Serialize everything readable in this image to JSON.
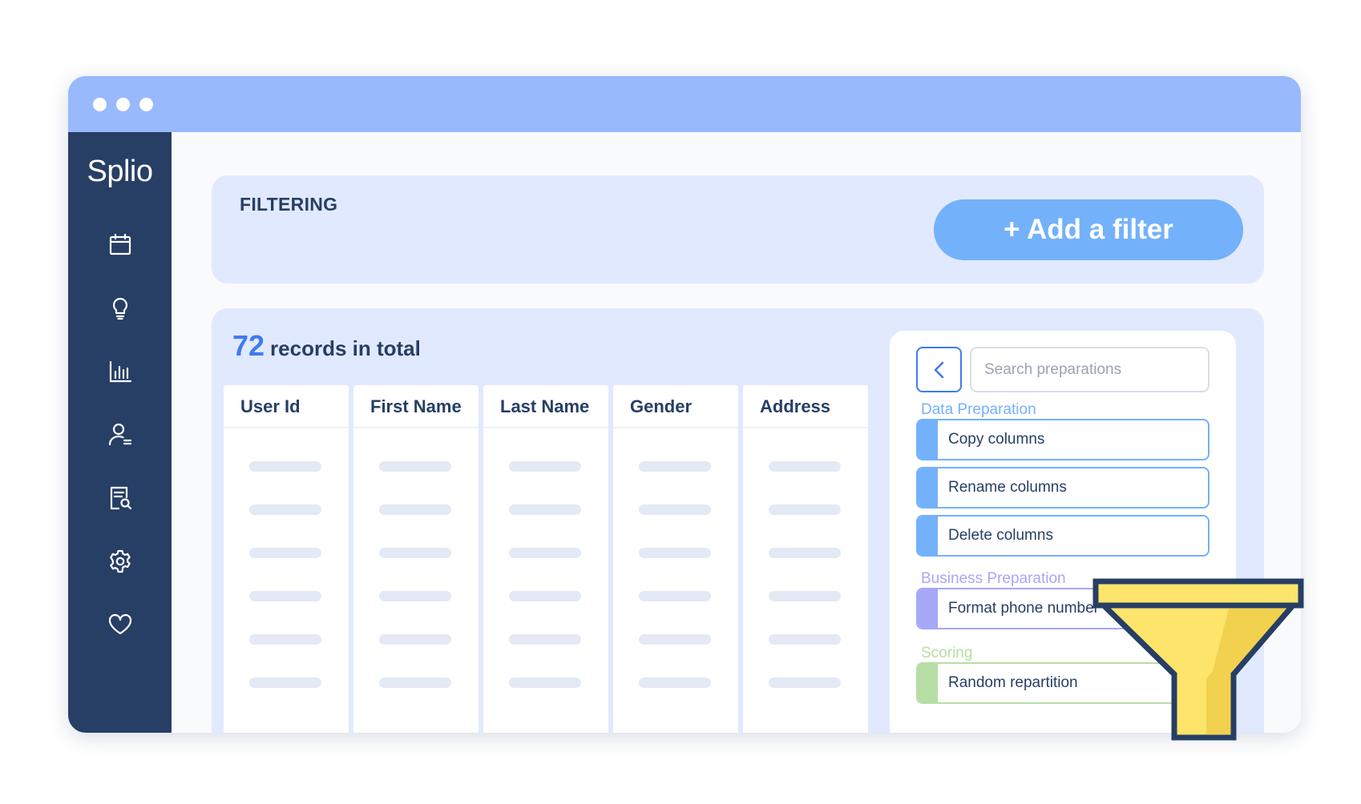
{
  "window": {
    "control_dots": [
      "dot",
      "dot",
      "dot"
    ]
  },
  "sidebar": {
    "logo": "Splio",
    "items": [
      {
        "icon": "calendar-icon"
      },
      {
        "icon": "lightbulb-icon"
      },
      {
        "icon": "bar-chart-icon"
      },
      {
        "icon": "user-list-icon"
      },
      {
        "icon": "document-search-icon"
      },
      {
        "icon": "gear-icon"
      },
      {
        "icon": "heart-icon"
      }
    ]
  },
  "filtering": {
    "title": "FILTERING",
    "add_filter_label": "+ Add a filter"
  },
  "records": {
    "count": "72",
    "label": "records in total",
    "columns": [
      "User Id",
      "First Name",
      "Last Name",
      "Gender",
      "Address"
    ],
    "placeholder_rows": 6
  },
  "preparations": {
    "search_placeholder": "Search preparations",
    "back_icon": "chevron-left-icon",
    "sections": [
      {
        "label": "Data Preparation",
        "color": "#74b1fb",
        "items": [
          "Copy columns",
          "Rename columns",
          "Delete columns"
        ]
      },
      {
        "label": "Business Preparation",
        "color": "#a7a7f8",
        "items": [
          "Format phone number"
        ]
      },
      {
        "label": "Scoring",
        "color": "#b6dea5",
        "items": [
          "Random repartition"
        ]
      }
    ]
  },
  "colors": {
    "accent": "#3f7bf0",
    "sidebar_bg": "#273e65",
    "titlebar_bg": "#99b9fd",
    "card_bg": "#e1e9fe",
    "button_bg": "#74b1fb",
    "funnel_yellow": "#fde46b"
  },
  "decoration": {
    "funnel_icon": "funnel-icon"
  }
}
